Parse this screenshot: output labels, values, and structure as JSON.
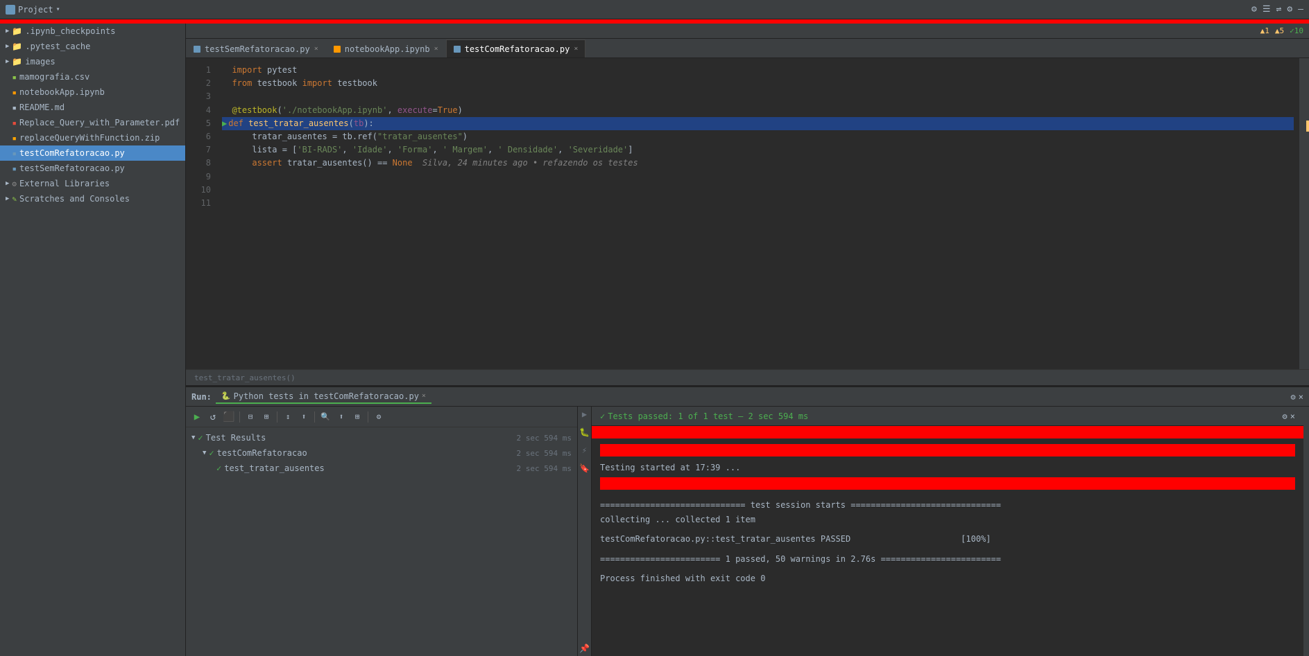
{
  "topbar": {
    "title": "Project",
    "chevron": "▾",
    "actions": [
      "⚙",
      "☰",
      "⇌",
      "⚙",
      "—"
    ]
  },
  "sidebar": {
    "items": [
      {
        "id": "ipynb_checkpoints",
        "label": ".ipynb_checkpoints",
        "type": "folder",
        "indent": 0
      },
      {
        "id": "pytest_cache",
        "label": ".pytest_cache",
        "type": "folder",
        "indent": 0
      },
      {
        "id": "images",
        "label": "images",
        "type": "folder",
        "indent": 0
      },
      {
        "id": "mamografia_csv",
        "label": "mamografia.csv",
        "type": "csv",
        "indent": 0
      },
      {
        "id": "notebookApp_ipynb",
        "label": "notebookApp.ipynb",
        "type": "ipynb",
        "indent": 0
      },
      {
        "id": "README_md",
        "label": "README.md",
        "type": "md",
        "indent": 0
      },
      {
        "id": "Replace_Query",
        "label": "Replace_Query_with_Parameter.pdf",
        "type": "pdf",
        "indent": 0
      },
      {
        "id": "replaceQuery_zip",
        "label": "replaceQueryWithFunction.zip",
        "type": "zip",
        "indent": 0
      },
      {
        "id": "testComRefatoracao_py",
        "label": "testComRefatoracao.py",
        "type": "py",
        "indent": 0,
        "active": true
      },
      {
        "id": "testSemRefatoracao_py",
        "label": "testSemRefatoracao.py",
        "type": "py",
        "indent": 0
      },
      {
        "id": "external_libraries",
        "label": "External Libraries",
        "type": "folder-special",
        "indent": 0
      },
      {
        "id": "scratches",
        "label": "Scratches and Consoles",
        "type": "scratches",
        "indent": 0
      }
    ]
  },
  "tabs": [
    {
      "id": "tab1",
      "label": "testSemRefatoracao.py",
      "active": false
    },
    {
      "id": "tab2",
      "label": "notebookApp.ipynb",
      "active": false
    },
    {
      "id": "tab3",
      "label": "testComRefatoracao.py",
      "active": true
    }
  ],
  "status_top": {
    "warning1": "▲1",
    "warning5": "▲5",
    "ok10": "✓10"
  },
  "code": {
    "lines": [
      {
        "num": 1,
        "content": "",
        "tokens": [
          {
            "text": "import pytest",
            "class": ""
          }
        ]
      },
      {
        "num": 2,
        "content": "",
        "tokens": [
          {
            "text": "from testbook import testbook",
            "class": ""
          }
        ]
      },
      {
        "num": 3,
        "content": ""
      },
      {
        "num": 4,
        "content": "",
        "tokens": []
      },
      {
        "num": 5,
        "content": "",
        "highlighted": true
      },
      {
        "num": 6,
        "content": ""
      },
      {
        "num": 7,
        "content": ""
      },
      {
        "num": 8,
        "content": ""
      },
      {
        "num": 9,
        "content": ""
      },
      {
        "num": 10,
        "content": ""
      },
      {
        "num": 11,
        "content": ""
      }
    ],
    "breadcrumb": "test_tratar_ausentes()"
  },
  "run_panel": {
    "label": "Run:",
    "tab_label": "Python tests in testComRefatoracao.py",
    "test_passed_msg": "Tests passed: 1 of 1 test – 2 sec 594 ms",
    "results": {
      "header": "Test Results",
      "header_time": "2 sec 594 ms",
      "groups": [
        {
          "name": "testComRefatoracao",
          "time": "2 sec 594 ms",
          "tests": [
            {
              "name": "test_tratar_ausentes",
              "time": "2 sec 594 ms"
            }
          ]
        }
      ]
    },
    "output": {
      "start_msg": "Testing started at 17:39 ...",
      "separator1": "============================= test session starts ==============================",
      "collecting": "collecting ... collected 1 item",
      "blank1": "",
      "test_result": "testComRefatoracao.py::test_tratar_ausentes PASSED                      [100%]",
      "blank2": "",
      "summary": "======================== 1 passed, 50 warnings in 2.76s ========================",
      "blank3": "",
      "finish": "Process finished with exit code 0"
    }
  }
}
